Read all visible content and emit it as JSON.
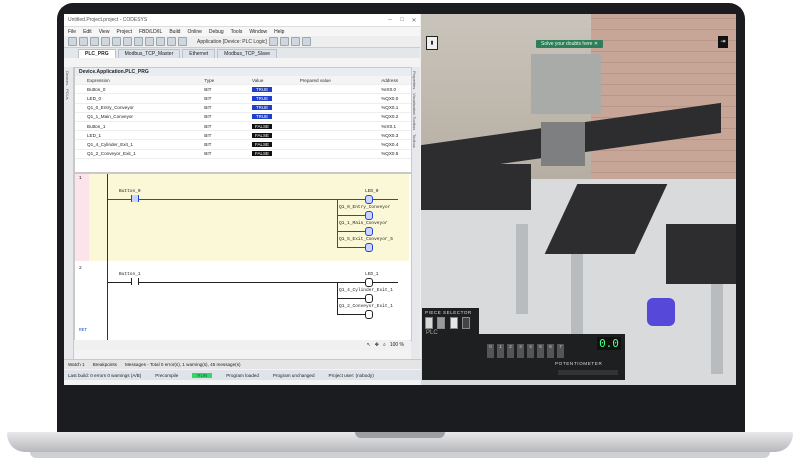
{
  "window": {
    "title": "Untitled.Project.project - CODESYS"
  },
  "menu": [
    "File",
    "Edit",
    "View",
    "Project",
    "FBD/LD/IL",
    "Build",
    "Online",
    "Debug",
    "Tools",
    "Window",
    "Help"
  ],
  "toolbar": {
    "application": "Application [Device: PLC Logic]"
  },
  "tabs": [
    {
      "label": "PLC_PRG",
      "active": true
    },
    {
      "label": "Modbus_TCP_Master",
      "active": false
    },
    {
      "label": "Ethernet",
      "active": false
    },
    {
      "label": "Modbus_TCP_Slave",
      "active": false
    }
  ],
  "side_left": [
    "Devices",
    "POUs"
  ],
  "side_right": [
    "Properties",
    "Visualization Toolbox",
    "Toolbox"
  ],
  "watch": {
    "title": "Device.Application.PLC_PRG",
    "headers": [
      "Expression",
      "Type",
      "Value",
      "Prepared value",
      "Address"
    ],
    "rows": [
      {
        "name": "Button_0",
        "type": "BIT",
        "value": "TRUE",
        "addr": "%IX0.0"
      },
      {
        "name": "LED_0",
        "type": "BIT",
        "value": "TRUE",
        "addr": "%QX0.0"
      },
      {
        "name": "Q1_0_Entry_Conveyor",
        "type": "BIT",
        "value": "TRUE",
        "addr": "%QX0.1"
      },
      {
        "name": "Q1_1_Main_Conveyor",
        "type": "BIT",
        "value": "TRUE",
        "addr": "%QX0.2"
      },
      {
        "name": "Button_1",
        "type": "BIT",
        "value": "FALSE",
        "addr": "%IX0.1"
      },
      {
        "name": "LED_1",
        "type": "BIT",
        "value": "FALSE",
        "addr": "%QX0.3"
      },
      {
        "name": "Q1_4_Cylinder_Exit_1",
        "type": "BIT",
        "value": "FALSE",
        "addr": "%QX0.4"
      },
      {
        "name": "Q1_2_Conveyor_Exit_1",
        "type": "BIT",
        "value": "FALSE",
        "addr": "%QX0.5"
      }
    ]
  },
  "ladder": {
    "rung1": {
      "num": "1",
      "contact": "Button_0",
      "coils": [
        "LED_0",
        "Q1_0_Entry_Conveyor",
        "Q1_1_Main_Conveyor",
        "Q1_5_Exit_Conveyor_5"
      ]
    },
    "rung2": {
      "num": "2",
      "contact": "Button_1",
      "coils": [
        "LED_1",
        "Q1_4_Cylinder_Exit_1",
        "Q1_2_Conveyor_Exit_1"
      ]
    },
    "end_label": "RET"
  },
  "zoom": "100 %",
  "messages": {
    "watch": "Watch 1",
    "breakpoints": "Breakpoints",
    "summary": "Messages - Total 0 error(s), 1 warning(s), 45 message(s)"
  },
  "status": {
    "user": "Last build: 0 errors 0 warnings (A/B)",
    "precompile": "Precompile",
    "run": "RUN",
    "program": "Program loaded",
    "changes": "Program unchanged",
    "project_user": "Project user: (nobody)"
  },
  "sim": {
    "hint": "Solve your doubts here",
    "piece_selector": "PIECE SELECTOR",
    "plc_label": "PLC",
    "display": "0.0",
    "potentiometer": "POTENTIOMETER",
    "button_labels": [
      "0",
      "1",
      "2",
      "3",
      "4",
      "5",
      "6",
      "7"
    ],
    "swatch_colors": [
      "#d8d8d8",
      "#9a9a9a",
      "#e6e6e6",
      "#444444"
    ]
  }
}
